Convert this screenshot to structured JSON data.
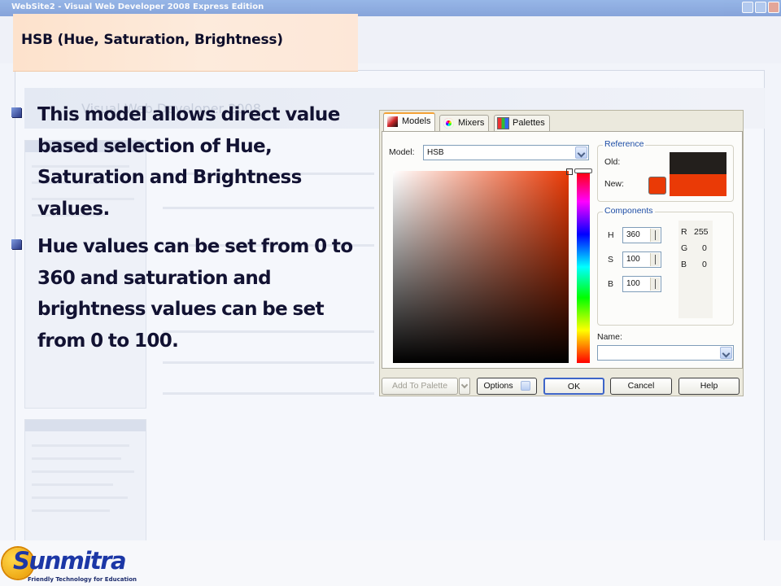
{
  "background_window": {
    "title": "WebSite2 - Visual Web Developer 2008 Express Edition",
    "banner": "Visual Web Developer 2008"
  },
  "slide": {
    "title": "HSB (Hue, Saturation, Brightness)",
    "bullets": [
      "This model allows direct value based selection of Hue, Saturation and Brightness values.",
      "Hue values can be set from 0 to 360 and saturation and brightness values can be set from 0 to 100."
    ]
  },
  "dialog": {
    "tabs": [
      "Models",
      "Mixers",
      "Palettes"
    ],
    "model_label": "Model:",
    "model_value": "HSB",
    "reference": {
      "title": "Reference",
      "old_label": "Old:",
      "new_label": "New:",
      "old_color": "#231f1c",
      "new_color": "#ea3a06"
    },
    "components": {
      "title": "Components",
      "h_label": "H",
      "h_value": "360",
      "s_label": "S",
      "s_value": "100",
      "b_label": "B",
      "b_value": "100",
      "r_label": "R",
      "r_value": "255",
      "g_label": "G",
      "g_value": "0",
      "bl_label": "B",
      "bl_value": "0"
    },
    "name_label": "Name:",
    "name_value": "",
    "buttons": {
      "add_to_palette": "Add To Palette",
      "options": "Options",
      "ok": "OK",
      "cancel": "Cancel",
      "help": "Help"
    }
  },
  "logo": {
    "name": "Sunmitra",
    "tagline": "Friendly Technology for Education"
  },
  "colors": {
    "accent": "#ea3a06",
    "title_bg": "#fde2cc",
    "text": "#121232"
  }
}
